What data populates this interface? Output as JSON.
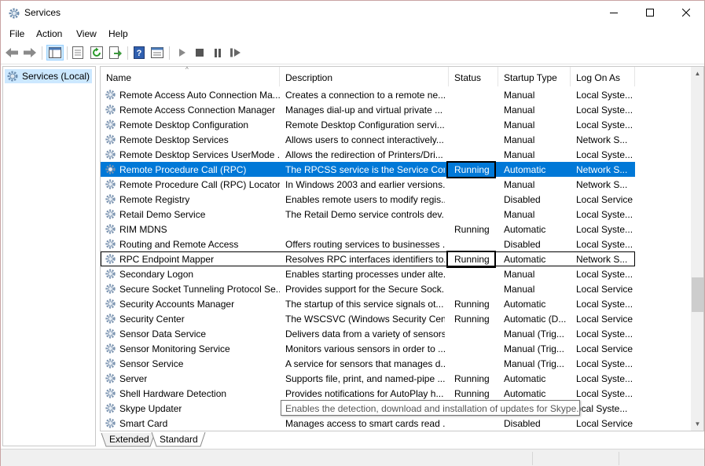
{
  "window": {
    "title": "Services"
  },
  "menu": [
    {
      "label": "File"
    },
    {
      "label": "Action"
    },
    {
      "label": "View"
    },
    {
      "label": "Help"
    }
  ],
  "tree": {
    "root": "Services (Local)"
  },
  "columns": [
    "Name",
    "Description",
    "Status",
    "Startup Type",
    "Log On As"
  ],
  "rows": [
    {
      "name": "Remote Access Auto Connection Ma...",
      "desc": "Creates a connection to a remote ne...",
      "status": "",
      "startup": "Manual",
      "logon": "Local Syste..."
    },
    {
      "name": "Remote Access Connection Manager",
      "desc": "Manages dial-up and virtual private ...",
      "status": "",
      "startup": "Manual",
      "logon": "Local Syste..."
    },
    {
      "name": "Remote Desktop Configuration",
      "desc": "Remote Desktop Configuration servi...",
      "status": "",
      "startup": "Manual",
      "logon": "Local Syste..."
    },
    {
      "name": "Remote Desktop Services",
      "desc": "Allows users to connect interactively...",
      "status": "",
      "startup": "Manual",
      "logon": "Network S..."
    },
    {
      "name": "Remote Desktop Services UserMode ...",
      "desc": "Allows the redirection of Printers/Dri...",
      "status": "",
      "startup": "Manual",
      "logon": "Local Syste..."
    },
    {
      "name": "Remote Procedure Call (RPC)",
      "desc": "The RPCSS service is the Service Con...",
      "status": "Running",
      "startup": "Automatic",
      "logon": "Network S...",
      "selected": true,
      "boxed": true
    },
    {
      "name": "Remote Procedure Call (RPC) Locator",
      "desc": "In Windows 2003 and earlier versions...",
      "status": "",
      "startup": "Manual",
      "logon": "Network S..."
    },
    {
      "name": "Remote Registry",
      "desc": "Enables remote users to modify regis...",
      "status": "",
      "startup": "Disabled",
      "logon": "Local Service"
    },
    {
      "name": "Retail Demo Service",
      "desc": "The Retail Demo service controls dev...",
      "status": "",
      "startup": "Manual",
      "logon": "Local Syste..."
    },
    {
      "name": "RIM MDNS",
      "desc": "",
      "status": "Running",
      "startup": "Automatic",
      "logon": "Local Syste..."
    },
    {
      "name": "Routing and Remote Access",
      "desc": "Offers routing services to businesses ...",
      "status": "",
      "startup": "Disabled",
      "logon": "Local Syste..."
    },
    {
      "name": "RPC Endpoint Mapper",
      "desc": "Resolves RPC interfaces identifiers to...",
      "status": "Running",
      "startup": "Automatic",
      "logon": "Network S...",
      "focused": true,
      "boxed": true
    },
    {
      "name": "Secondary Logon",
      "desc": "Enables starting processes under alte...",
      "status": "",
      "startup": "Manual",
      "logon": "Local Syste..."
    },
    {
      "name": "Secure Socket Tunneling Protocol Se...",
      "desc": "Provides support for the Secure Sock...",
      "status": "",
      "startup": "Manual",
      "logon": "Local Service"
    },
    {
      "name": "Security Accounts Manager",
      "desc": "The startup of this service signals ot...",
      "status": "Running",
      "startup": "Automatic",
      "logon": "Local Syste..."
    },
    {
      "name": "Security Center",
      "desc": "The WSCSVC (Windows Security Cen...",
      "status": "Running",
      "startup": "Automatic (D...",
      "logon": "Local Service"
    },
    {
      "name": "Sensor Data Service",
      "desc": "Delivers data from a variety of sensors",
      "status": "",
      "startup": "Manual (Trig...",
      "logon": "Local Syste..."
    },
    {
      "name": "Sensor Monitoring Service",
      "desc": "Monitors various sensors in order to ...",
      "status": "",
      "startup": "Manual (Trig...",
      "logon": "Local Service"
    },
    {
      "name": "Sensor Service",
      "desc": "A service for sensors that manages d...",
      "status": "",
      "startup": "Manual (Trig...",
      "logon": "Local Syste..."
    },
    {
      "name": "Server",
      "desc": "Supports file, print, and named-pipe ...",
      "status": "Running",
      "startup": "Automatic",
      "logon": "Local Syste..."
    },
    {
      "name": "Shell Hardware Detection",
      "desc": "Provides notifications for AutoPlay h...",
      "status": "Running",
      "startup": "Automatic",
      "logon": "Local Syste..."
    },
    {
      "name": "Skype Updater",
      "desc": "",
      "status": "",
      "startup": "",
      "logon": "ocal Syste..."
    },
    {
      "name": "Smart Card",
      "desc": "Manages access to smart cards read ...",
      "status": "",
      "startup": "Disabled",
      "logon": "Local Service"
    }
  ],
  "tooltip": "Enables the detection, download and installation of updates for Skype.",
  "tabs": [
    {
      "label": "Extended"
    },
    {
      "label": "Standard",
      "active": true
    }
  ],
  "colors": {
    "selection": "#0078d7",
    "tree_selection": "#cce8ff"
  }
}
